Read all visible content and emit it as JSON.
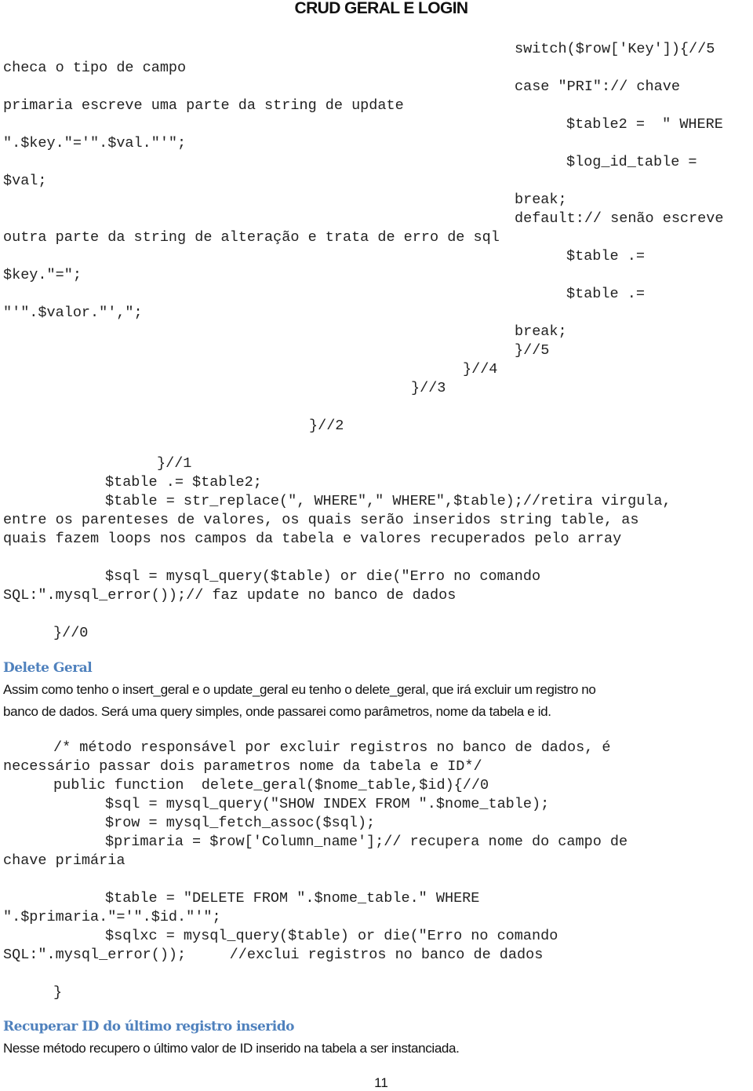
{
  "document": {
    "title": "CRUD GERAL E LOGIN",
    "page_number": "11"
  },
  "update_block": {
    "lines": [
      "switch($row['Key']){//5",
      "checa o tipo de campo",
      "case \"PRI\":// chave",
      "primaria escreve uma parte da string de update",
      "$table2 =  \" WHERE",
      "\".$key.\"='\".$val.\"'\";",
      "$log_id_table =",
      "$val;",
      "break;",
      "default:// senão escreve",
      "outra parte da string de alteração e trata de erro de sql",
      "$table .=",
      "$key.\"=\";",
      "$table .=",
      "\"'\".$valor.\"',\";",
      "break;",
      "}//5",
      "}//4",
      "}//3",
      "}//2",
      "}//1",
      "$table .= $table2;",
      "$table = str_replace(\", WHERE\",\" WHERE\",$table);//retira virgula,",
      "entre os parenteses de valores, os quais serão inseridos string table, as",
      "quais fazem loops nos campos da tabela e valores recuperados pelo array",
      "$sql = mysql_query($table) or die(\"Erro no comando",
      "SQL:\".mysql_error());// faz update no banco de dados",
      "}//0"
    ]
  },
  "delete_section": {
    "heading": "Delete Geral",
    "paragraph": [
      "Assim como tenho o insert_geral e o update_geral eu tenho o delete_geral, que irá excluir um registro no",
      "banco de dados. Será uma query simples, onde passarei como parâmetros, nome da tabela e id."
    ],
    "code": [
      "/* método responsável por excluir registros no banco de dados, é",
      "necessário passar dois parametros nome da tabela e ID*/",
      "public function  delete_geral($nome_table,$id){//0",
      "$sql = mysql_query(\"SHOW INDEX FROM \".$nome_table);",
      "$row = mysql_fetch_assoc($sql);",
      "$primaria = $row['Column_name'];// recupera nome do campo de",
      "chave primária",
      "$table = \"DELETE FROM \".$nome_table.\" WHERE",
      "\".$primaria.\"='\".$id.\"'\";",
      "$sqlxc = mysql_query($table) or die(\"Erro no comando",
      "SQL:\".mysql_error());     //exclui registros no banco de dados",
      "}"
    ]
  },
  "recover_section": {
    "heading": "Recuperar ID do último registro inserido",
    "paragraph": "Nesse método recupero o último valor de ID inserido na tabela a ser instanciada."
  }
}
